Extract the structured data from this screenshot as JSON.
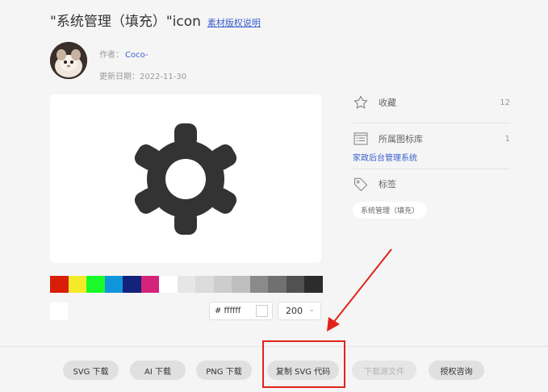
{
  "header": {
    "title": "\"系统管理（填充）\"icon",
    "copyright_link": "素材版权说明"
  },
  "author": {
    "label": "作者：",
    "name": "Coco-",
    "date_label": "更新日期：",
    "date": "2022-11-30"
  },
  "preview": {
    "icon": "gear-icon",
    "color": "#333333"
  },
  "palette": {
    "colors": [
      "#d81e06",
      "#f4ea2a",
      "#1afa29",
      "#1296db",
      "#13227a",
      "#d4237a",
      "#ffffff",
      "#e6e6e6",
      "#dbdbdb",
      "#cdcdcd",
      "#bfbfbf",
      "#8a8a8a",
      "#707070",
      "#515151",
      "#2c2c2c"
    ],
    "custom_color": "#ffffff"
  },
  "controls": {
    "color_value": "# ffffff",
    "size_value": "200"
  },
  "sidebar": {
    "favorites_label": "收藏",
    "favorites_count": "12",
    "library_label": "所属图标库",
    "library_count": "1",
    "library_name": "家政后台管理系统",
    "tags_label": "标签",
    "tag": "系统管理（填充）"
  },
  "actions": {
    "svg_download": "SVG 下载",
    "ai_download": "AI 下载",
    "png_download": "PNG 下载",
    "copy_svg": "复制 SVG 代码",
    "source_download": "下载源文件",
    "license": "授权咨询"
  },
  "annotation": {
    "color": "#e0241b"
  }
}
